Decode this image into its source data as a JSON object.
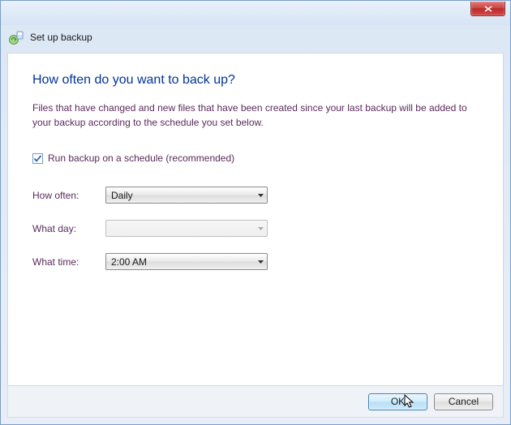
{
  "titlebar": {
    "title": "Set up backup"
  },
  "content": {
    "heading": "How often do you want to back up?",
    "description": "Files that have changed and new files that have been created since your last backup will be added to your backup according to the schedule you set below.",
    "checkbox": {
      "checked": true,
      "label": "Run backup on a schedule (recommended)"
    },
    "fields": {
      "how_often": {
        "label": "How often:",
        "value": "Daily",
        "disabled": false
      },
      "what_day": {
        "label": "What day:",
        "value": "",
        "disabled": true
      },
      "what_time": {
        "label": "What time:",
        "value": "2:00 AM",
        "disabled": false
      }
    }
  },
  "buttons": {
    "ok": "OK",
    "cancel": "Cancel"
  }
}
